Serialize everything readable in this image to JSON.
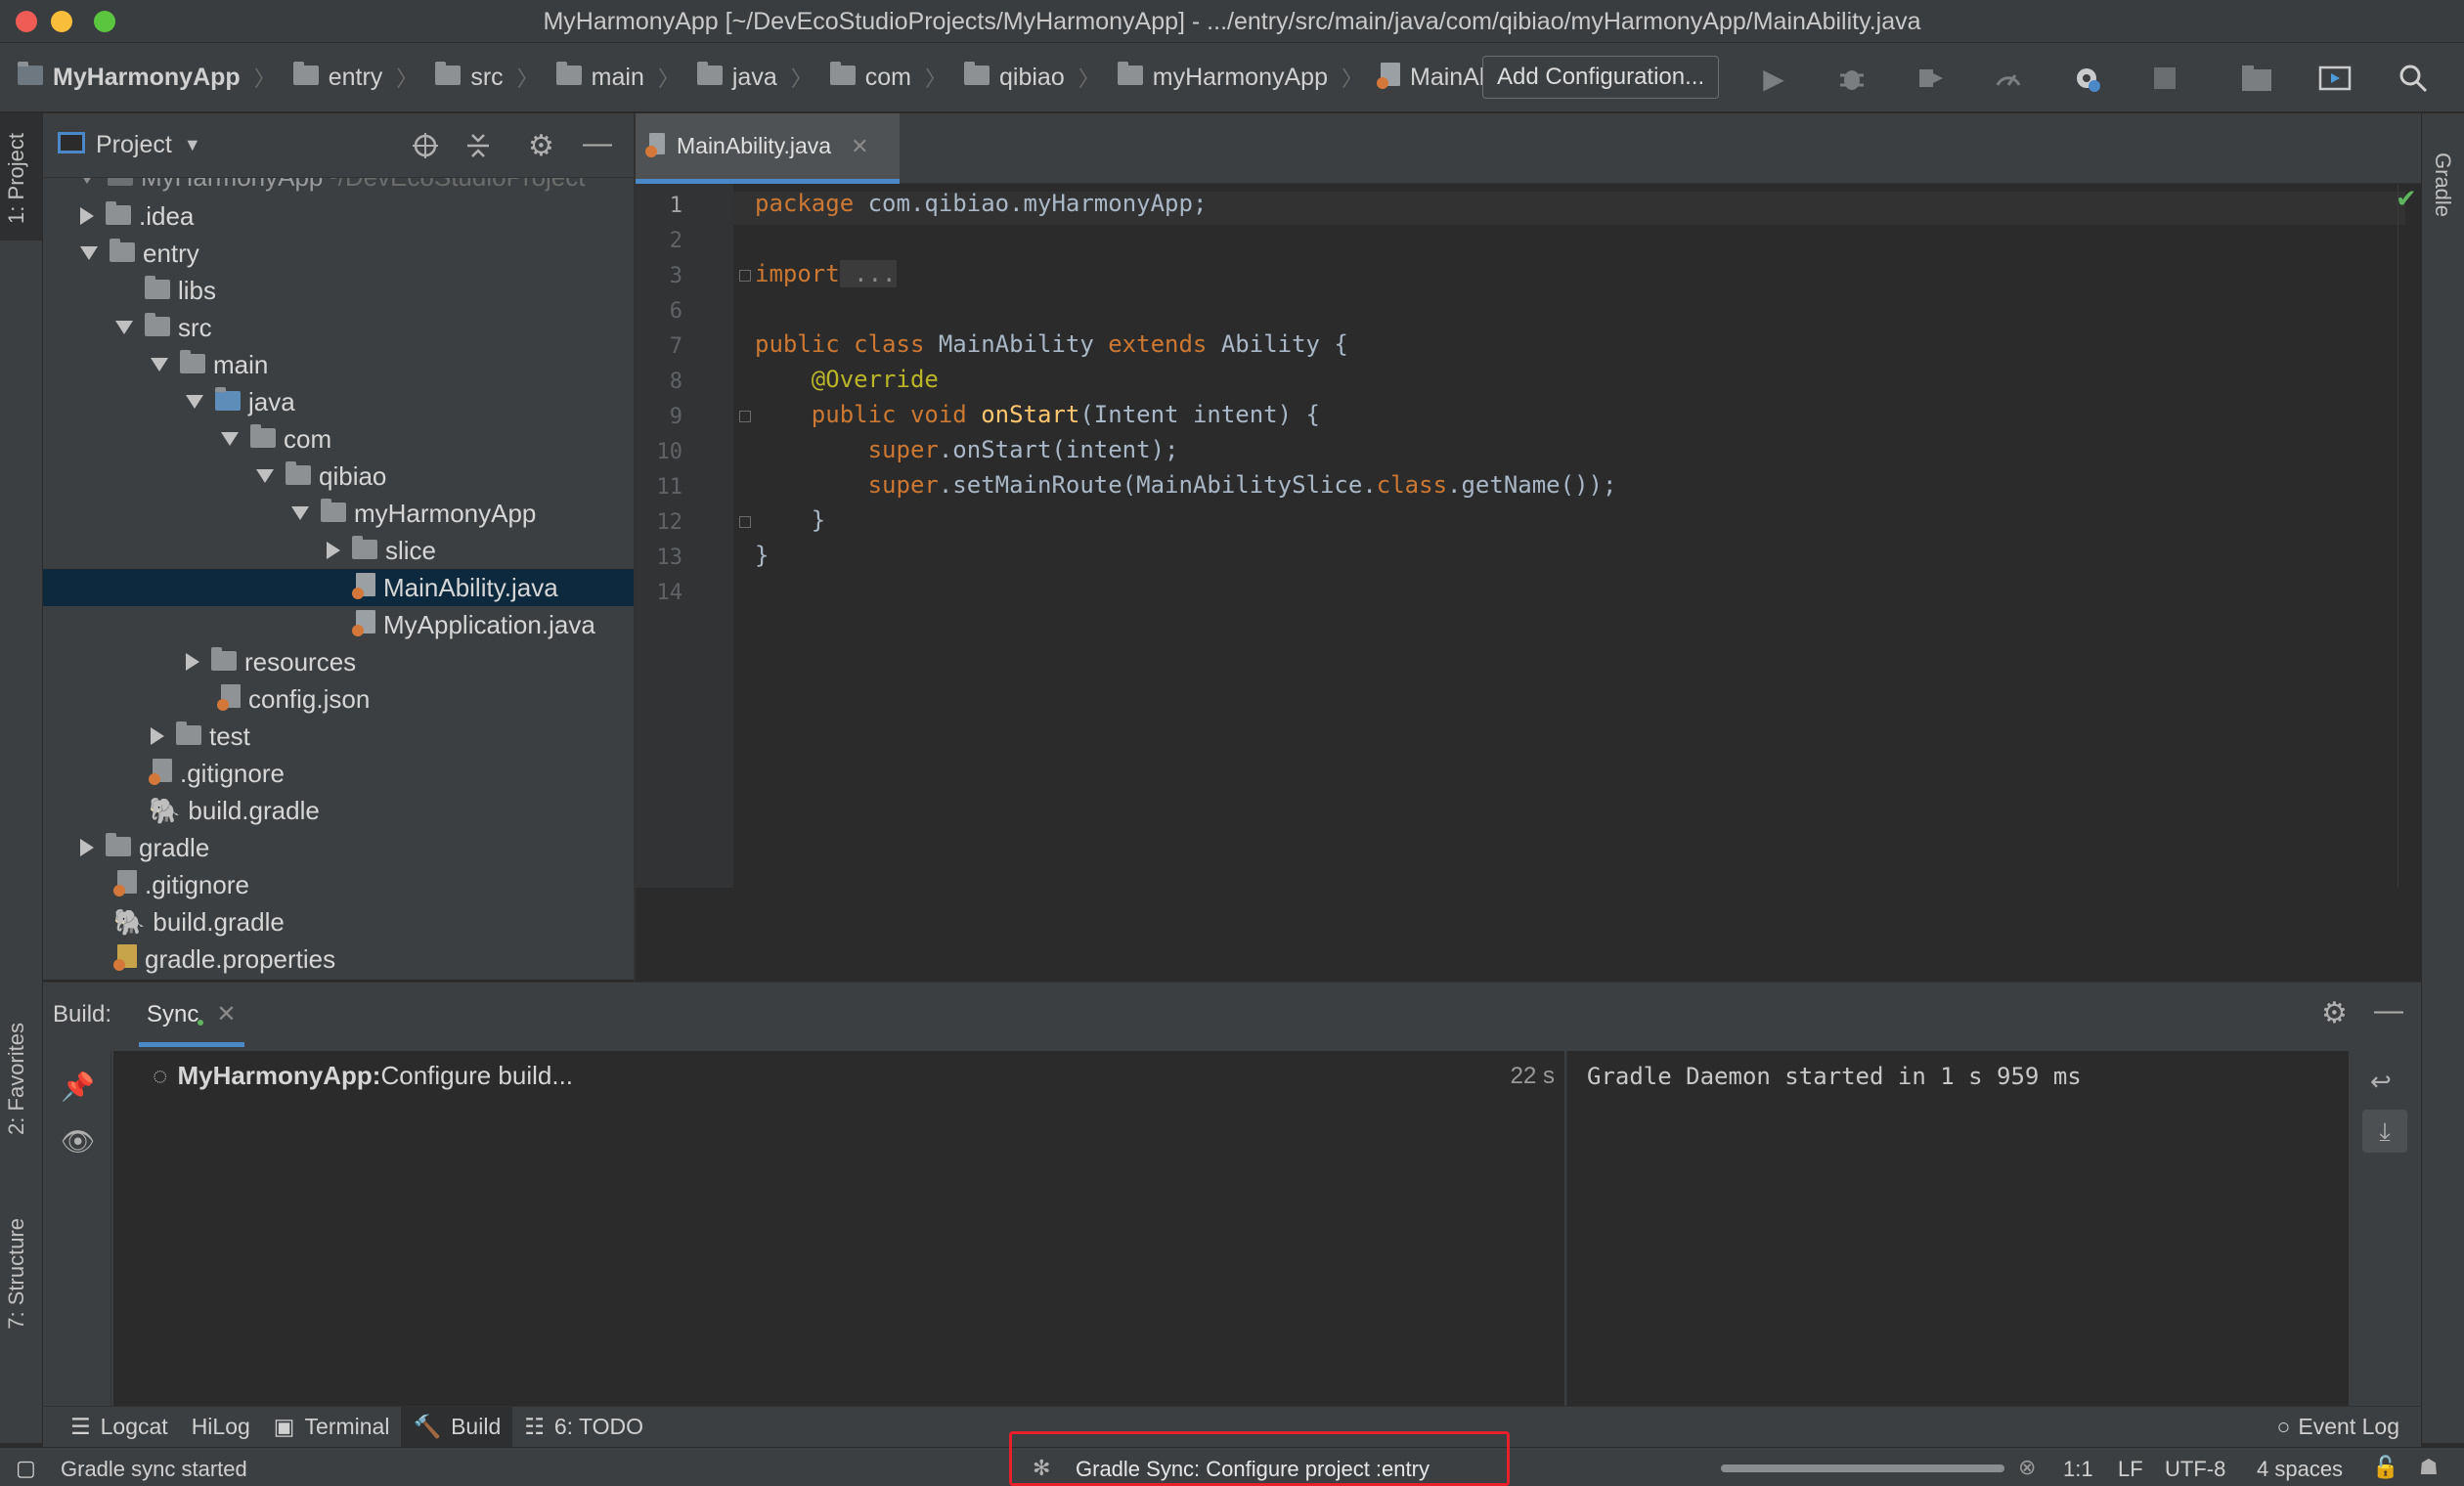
{
  "window": {
    "title": "MyHarmonyApp [~/DevEcoStudioProjects/MyHarmonyApp] - .../entry/src/main/java/com/qibiao/myHarmonyApp/MainAbility.java"
  },
  "breadcrumbs": [
    "MyHarmonyApp",
    "entry",
    "src",
    "main",
    "java",
    "com",
    "qibiao",
    "myHarmonyApp",
    "MainAbility.java"
  ],
  "toolbar": {
    "add_configuration": "Add Configuration...",
    "icons": [
      "run-icon",
      "debug-icon",
      "profile-icon",
      "attach-icon",
      "sync-icon",
      "stop-icon",
      "project-structure-icon",
      "device-icon",
      "search-icon"
    ]
  },
  "side_tabs": {
    "project": "1: Project",
    "favorites": "2: Favorites",
    "structure": "7: Structure",
    "gradle": "Gradle"
  },
  "project_panel": {
    "header": "Project",
    "tree": [
      {
        "label": "MyHarmonyApp",
        "suffix": " ~/DevEcoStudioProject"
      },
      {
        "label": ".idea"
      },
      {
        "label": "entry"
      },
      {
        "label": "libs"
      },
      {
        "label": "src"
      },
      {
        "label": "main"
      },
      {
        "label": "java"
      },
      {
        "label": "com"
      },
      {
        "label": "qibiao"
      },
      {
        "label": "myHarmonyApp"
      },
      {
        "label": "slice"
      },
      {
        "label": "MainAbility.java"
      },
      {
        "label": "MyApplication.java"
      },
      {
        "label": "resources"
      },
      {
        "label": "config.json"
      },
      {
        "label": "test"
      },
      {
        "label": ".gitignore"
      },
      {
        "label": "build.gradle"
      },
      {
        "label": "gradle"
      },
      {
        "label": ".gitignore"
      },
      {
        "label": "build.gradle"
      },
      {
        "label": "gradle.properties"
      }
    ]
  },
  "editor": {
    "tab": "MainAbility.java",
    "line_numbers": [
      "1",
      "2",
      "3",
      "6",
      "7",
      "8",
      "9",
      "10",
      "11",
      "12",
      "13",
      "14"
    ],
    "code": {
      "l1_kw": "package",
      "l1_rest": " com.qibiao.myHarmonyApp;",
      "l3_kw": "import",
      "l3_rest": " ...",
      "l7_kw1": "public class",
      "l7_mid": " MainAbility ",
      "l7_kw2": "extends",
      "l7_rest": " Ability {",
      "l8": "    @Override",
      "l9_kw": "    public void",
      "l9_fn": " onStart",
      "l9_rest": "(Intent intent) {",
      "l10_kw": "        super",
      "l10_rest": ".onStart(intent);",
      "l11_kw": "        super",
      "l11_mid": ".setMainRoute(MainAbilitySlice.",
      "l11_kw2": "class",
      "l11_rest": ".getName());",
      "l12": "    }",
      "l13": "}"
    }
  },
  "build_panel": {
    "label": "Build:",
    "tab": "Sync",
    "task_project": "MyHarmonyApp:",
    "task_text": " Configure build...",
    "elapsed": "22 s",
    "console": "Gradle Daemon started in 1 s 959 ms"
  },
  "tool_windows": [
    {
      "label": "Logcat"
    },
    {
      "label": "HiLog"
    },
    {
      "label": "Terminal"
    },
    {
      "label": "Build"
    },
    {
      "label": "6: TODO"
    }
  ],
  "event_log": "Event Log",
  "status": {
    "left": "Gradle sync started",
    "center": "Gradle Sync: Configure project :entry",
    "position": "1:1",
    "line_sep": "LF",
    "encoding": "UTF-8",
    "indent": "4 spaces"
  },
  "colors": {
    "accent": "#4a88c7",
    "highlight": "#e8202a",
    "keyword": "#cc7832"
  }
}
